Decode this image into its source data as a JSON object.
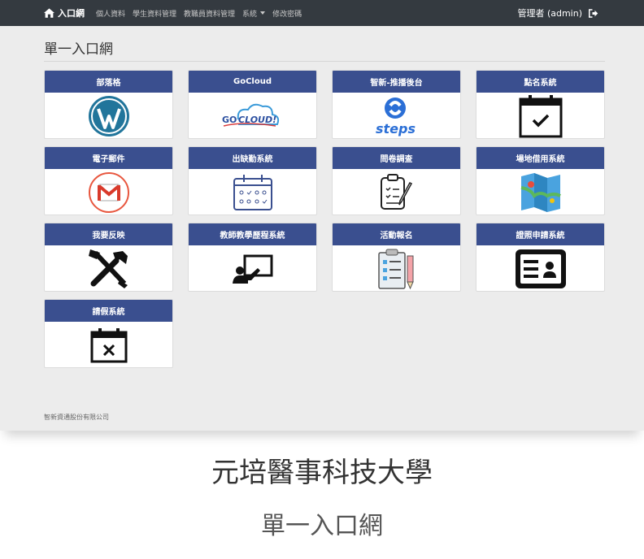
{
  "navbar": {
    "brand": "入口網",
    "links": [
      "個人資料",
      "學生資料管理",
      "教職員資料管理",
      "系統",
      "修改密碼"
    ],
    "user": "管理者 (admin)"
  },
  "page_title": "單一入口網",
  "cards": [
    {
      "label": "部落格",
      "icon": "wordpress-icon"
    },
    {
      "label": "GoCloud",
      "icon": "gocloud-logo"
    },
    {
      "label": "智新-推播後台",
      "icon": "steps-logo"
    },
    {
      "label": "點名系統",
      "icon": "calendar-check-icon"
    },
    {
      "label": "電子郵件",
      "icon": "gmail-icon"
    },
    {
      "label": "出缺勤系統",
      "icon": "calendar-grid-icon"
    },
    {
      "label": "問卷調查",
      "icon": "clipboard-pen-icon"
    },
    {
      "label": "場地借用系統",
      "icon": "map-icon"
    },
    {
      "label": "我要反映",
      "icon": "tools-icon"
    },
    {
      "label": "教師教學歷程系統",
      "icon": "teacher-board-icon"
    },
    {
      "label": "活動報名",
      "icon": "checklist-pencil-icon"
    },
    {
      "label": "證照申請系統",
      "icon": "id-card-icon"
    },
    {
      "label": "請假系統",
      "icon": "calendar-x-icon"
    }
  ],
  "footer": "智新資通股份有限公司",
  "caption": {
    "school": "元培醫事科技大學",
    "subtitle": "單一入口網"
  },
  "colors": {
    "navbar": "#343a40",
    "card_header": "#3a4f8f",
    "background": "#ececec"
  }
}
